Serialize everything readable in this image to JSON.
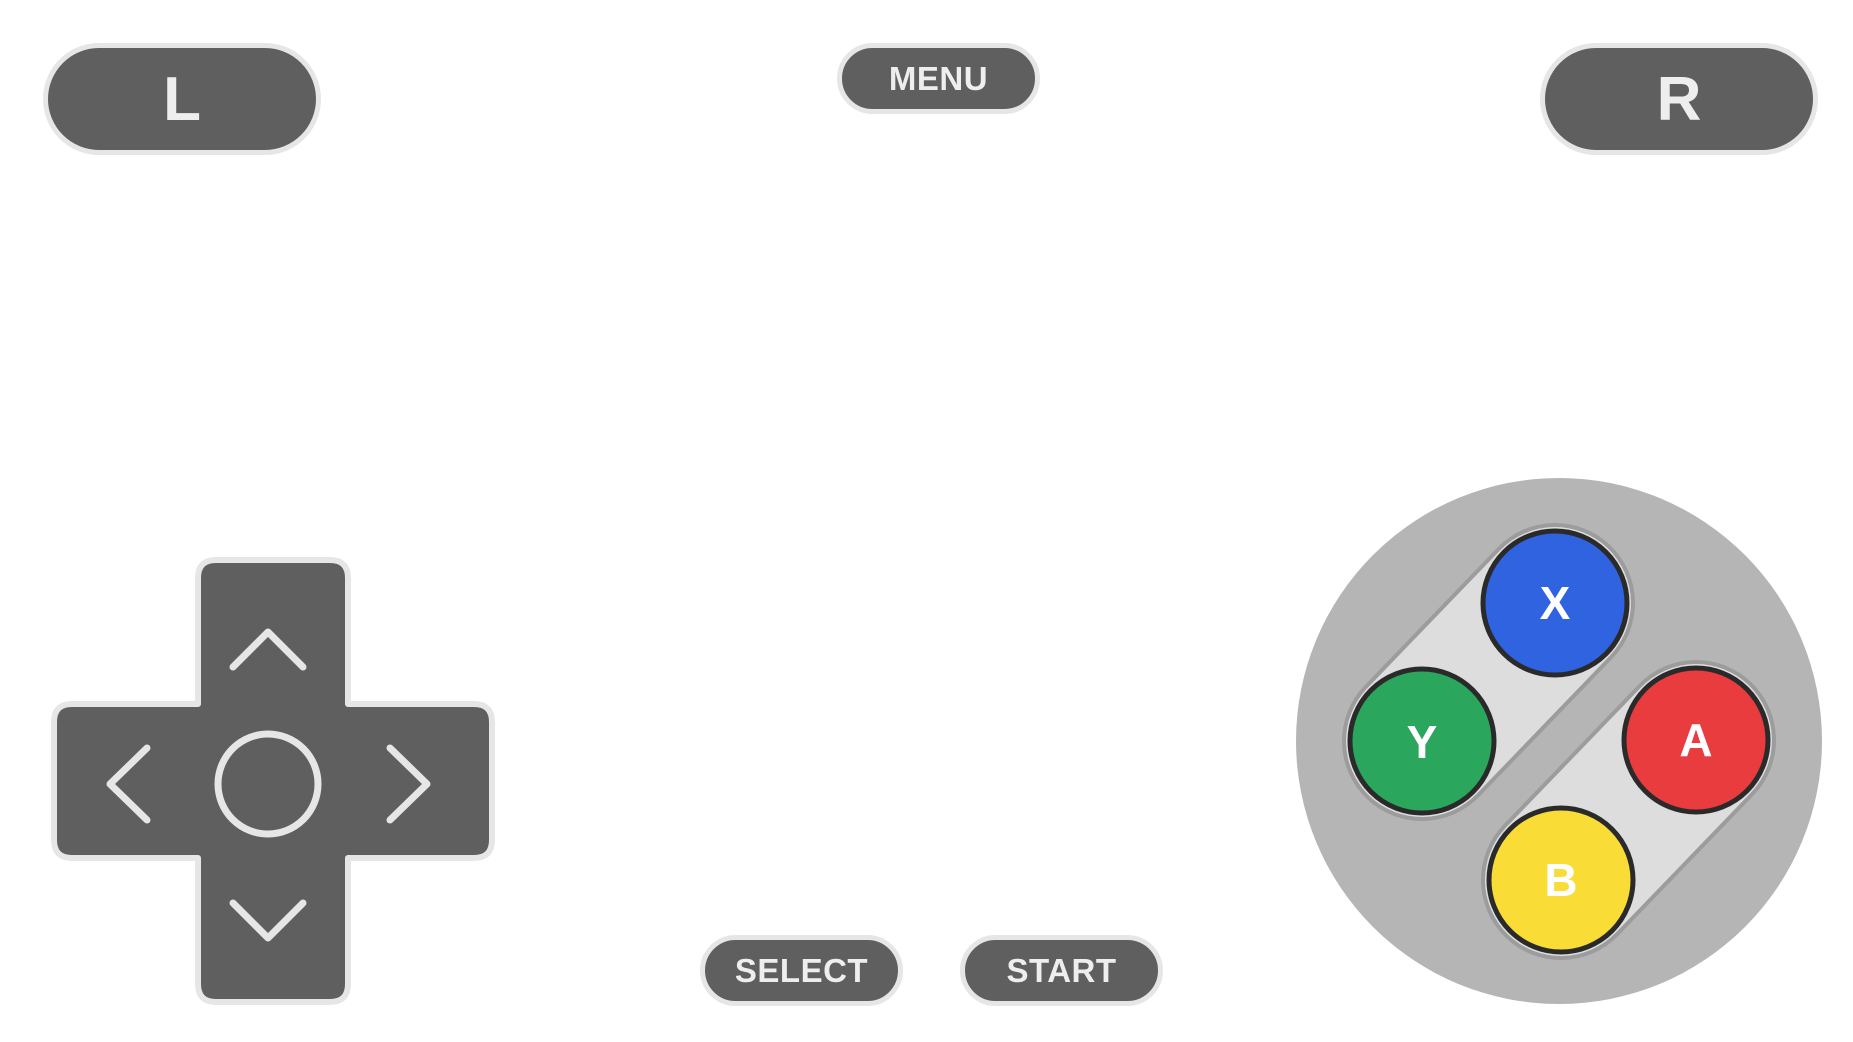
{
  "shoulder": {
    "l_label": "L",
    "r_label": "R"
  },
  "system": {
    "menu_label": "MENU",
    "select_label": "SELECT",
    "start_label": "START"
  },
  "dpad": {
    "icons": [
      "arrow-up-icon",
      "arrow-down-icon",
      "arrow-left-icon",
      "arrow-right-icon",
      "center-circle-icon"
    ]
  },
  "face_buttons": {
    "x": {
      "label": "X",
      "color": "#2f63e0",
      "text_color": "#ffffff"
    },
    "y": {
      "label": "Y",
      "color": "#2aa65d",
      "text_color": "#ffffff"
    },
    "a": {
      "label": "A",
      "color": "#e83c3f",
      "text_color": "#ffffff"
    },
    "b": {
      "label": "B",
      "color": "#f9dc35",
      "text_color": "#ffffff"
    }
  },
  "colors": {
    "button_fill": "#5f5f5f",
    "button_border": "#e6e6e6",
    "button_text": "#eeeeee",
    "face_plate": "#b5b5b5",
    "face_track": "#dddddd"
  }
}
